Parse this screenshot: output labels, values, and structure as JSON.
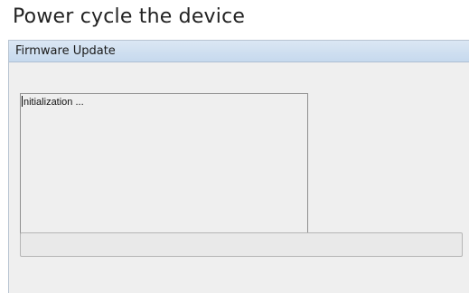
{
  "page": {
    "heading": "Power cycle the device"
  },
  "window": {
    "title": "Firmware Update",
    "log_text": "nitialization ...",
    "progress_value": 0
  }
}
